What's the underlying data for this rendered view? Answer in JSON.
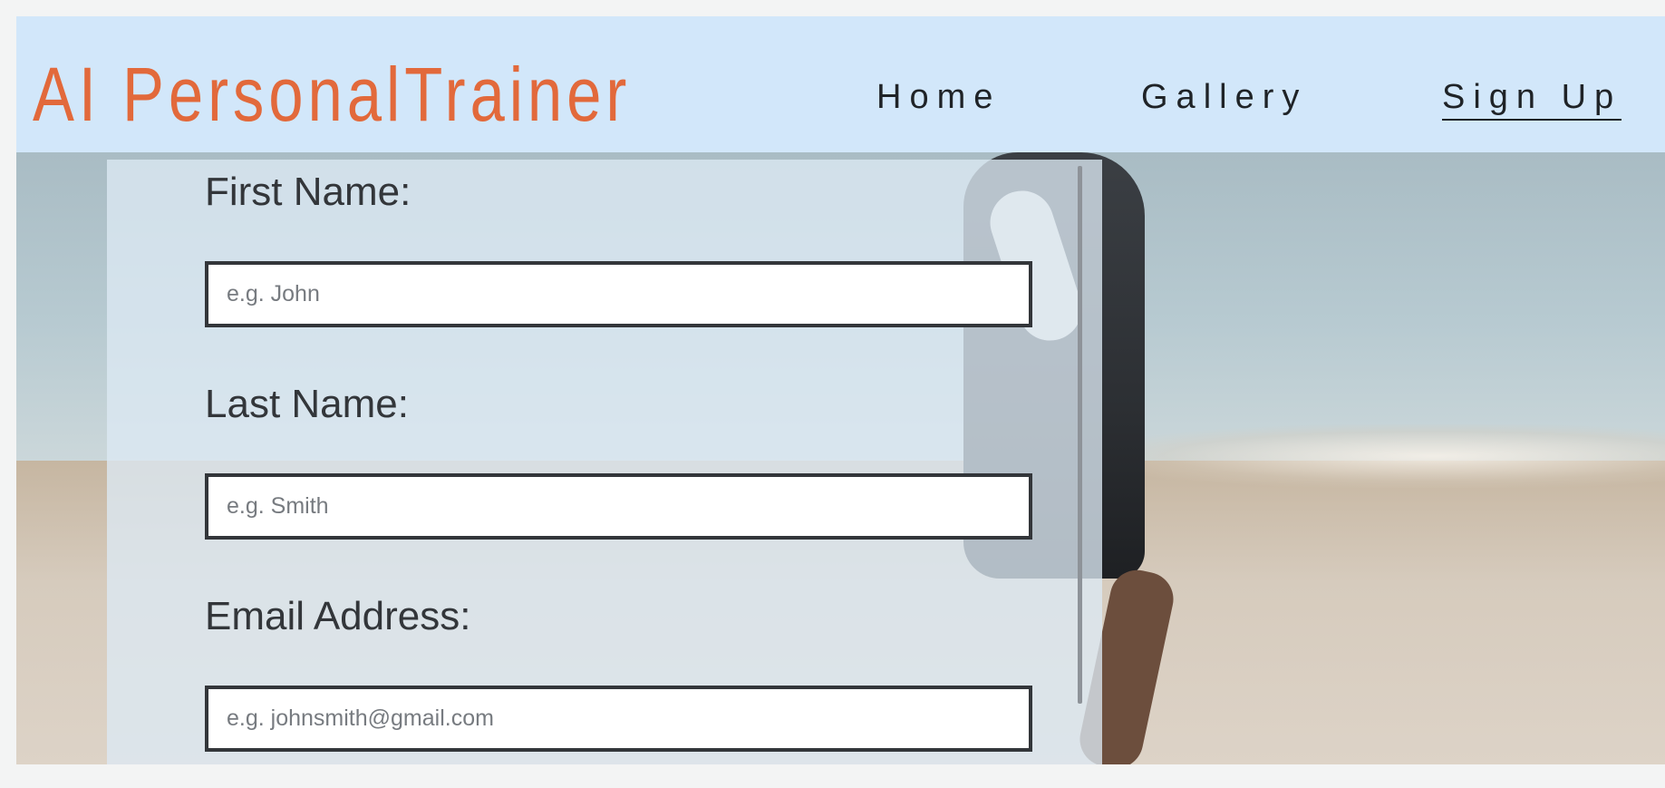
{
  "header": {
    "logo": "AI PersonalTrainer",
    "nav": {
      "home": "Home",
      "gallery": "Gallery",
      "signup": "Sign Up"
    }
  },
  "form": {
    "first_name": {
      "label": "First Name:",
      "placeholder": "e.g. John",
      "value": ""
    },
    "last_name": {
      "label": "Last Name:",
      "placeholder": "e.g. Smith",
      "value": ""
    },
    "email": {
      "label": "Email Address:",
      "placeholder": "e.g. johnsmith@gmail.com",
      "value": ""
    }
  },
  "colors": {
    "header_bg": "#d2e7fa",
    "logo": "#e2693b",
    "nav_text": "#1f2327",
    "form_text": "#33363a"
  },
  "icons": {
    "hero_image": "beach-runner-photo"
  }
}
